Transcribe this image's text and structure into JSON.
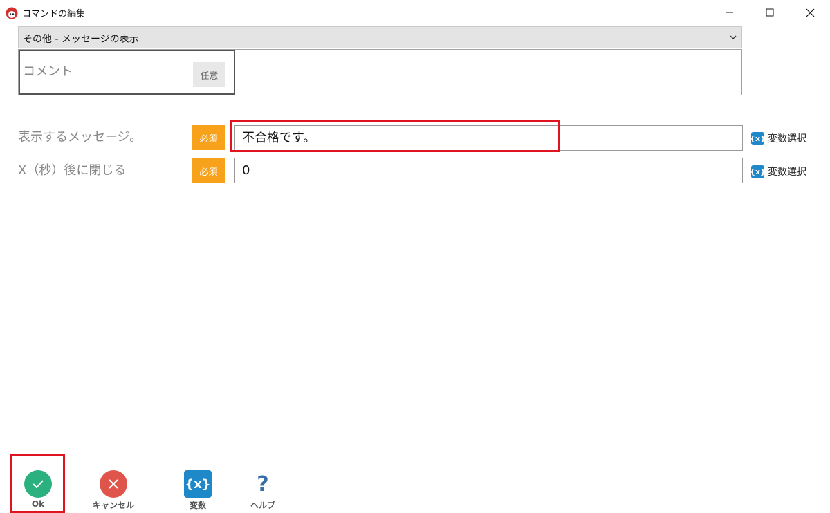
{
  "window": {
    "title": "コマンドの編集",
    "controls": {
      "minimize": "minimize",
      "maximize": "maximize",
      "close": "close"
    }
  },
  "command_select": {
    "value": "その他 - メッセージの表示"
  },
  "comment": {
    "label": "コメント",
    "badge": "任意",
    "value": ""
  },
  "fields": [
    {
      "label": "表示するメッセージ。",
      "badge": "必須",
      "value": "不合格です。",
      "var_link": "変数選択",
      "var_icon": "{x}"
    },
    {
      "label": "X（秒）後に閉じる",
      "badge": "必須",
      "value": "0",
      "var_link": "変数選択",
      "var_icon": "{x}"
    }
  ],
  "toolbar": {
    "ok": "Ok",
    "cancel": "キャンセル",
    "variables": "変数",
    "variables_icon": "{x}",
    "help": "ヘルプ",
    "help_icon": "?"
  },
  "colors": {
    "required_badge": "#f8a21b",
    "highlight": "#e0141e",
    "ok_green": "#2bb07f",
    "cancel_red": "#e0554b",
    "variable_blue": "#1e88c8",
    "help_blue": "#3a6ea8"
  }
}
